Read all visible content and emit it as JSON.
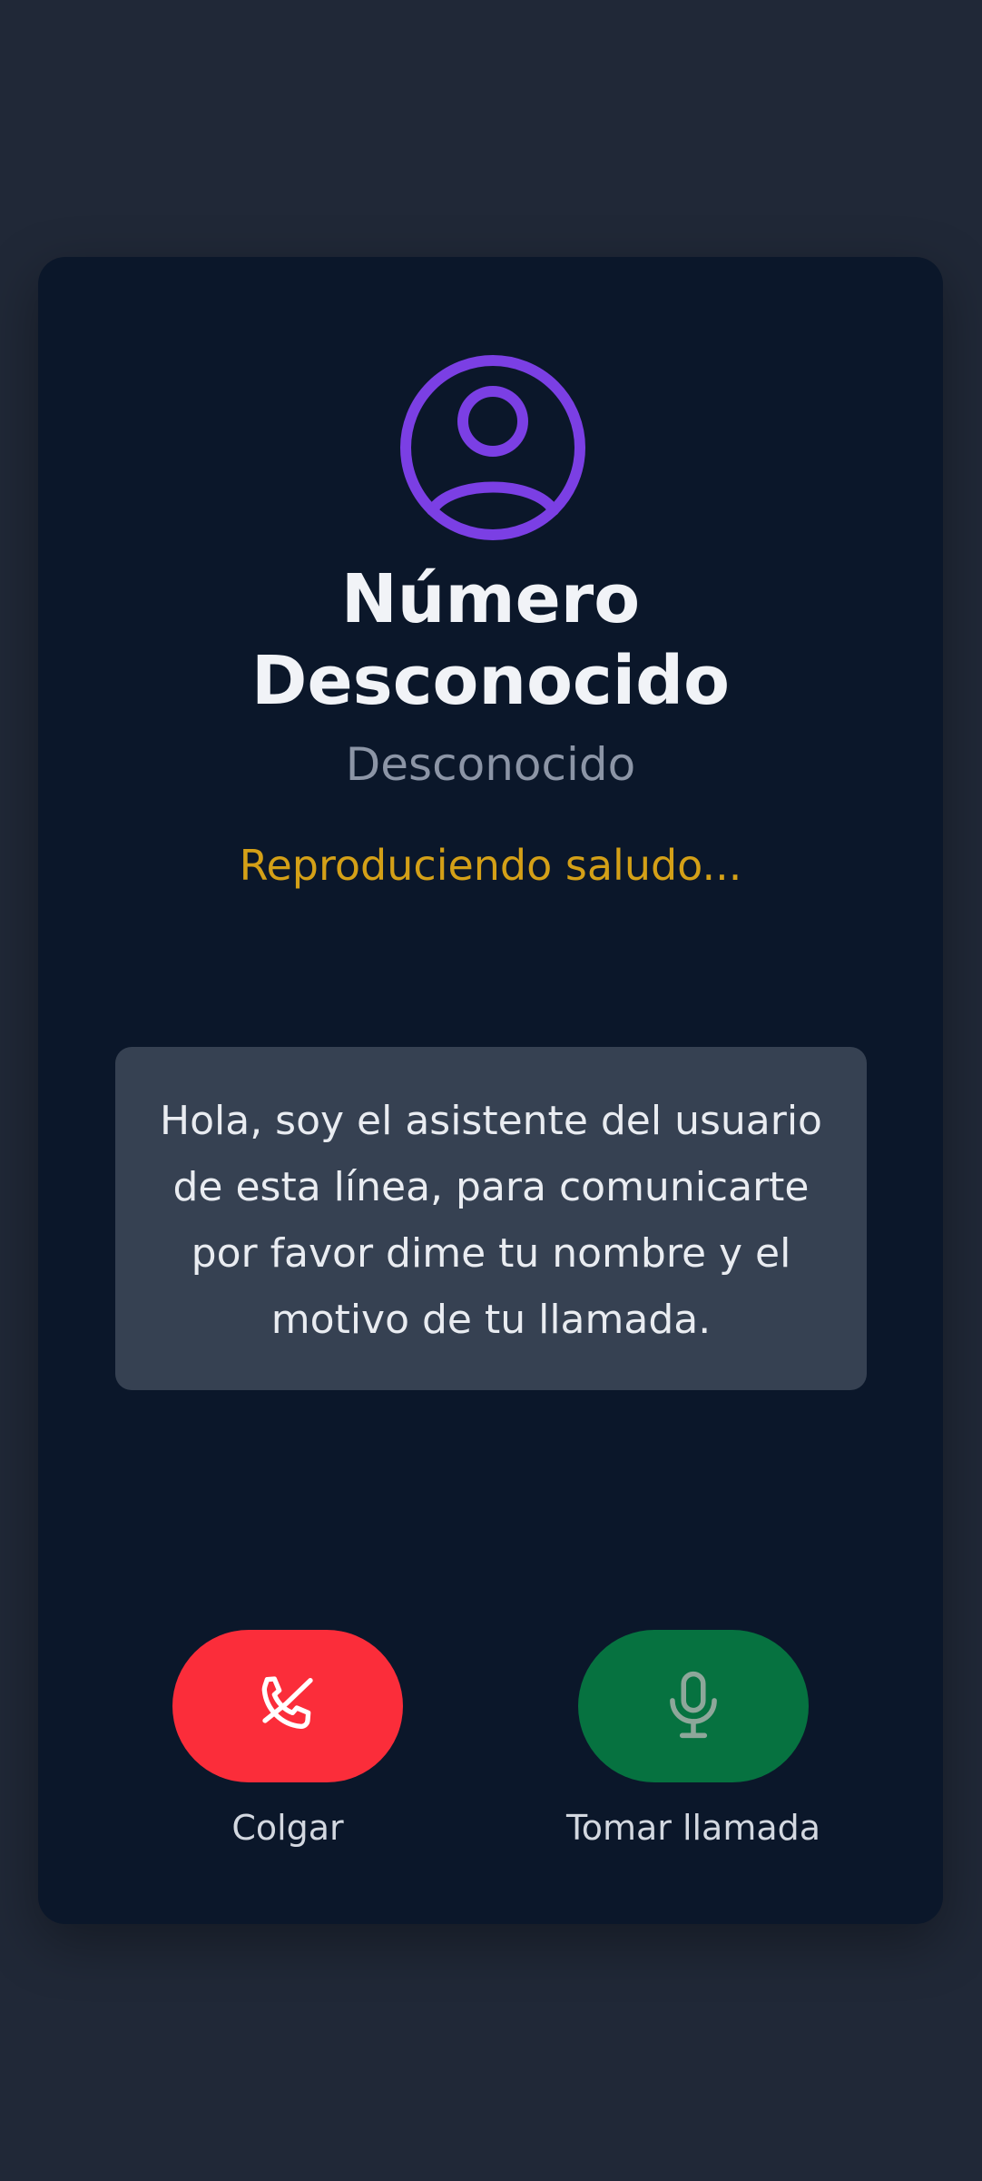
{
  "caller": {
    "name": "Número\nDesconocido",
    "subtitle": "Desconocido",
    "status": "Reproduciendo saludo..."
  },
  "greeting_message": "Hola, soy el asistente del usuario de esta línea, para comunicarte por favor dime tu nombre y el motivo de tu llamada.",
  "actions": {
    "hangup": {
      "label": "Colgar",
      "icon": "phone-hangup-icon",
      "color": "#fb2d3a"
    },
    "accept": {
      "label": "Tomar llamada",
      "icon": "microphone-icon",
      "color": "#067240"
    }
  },
  "colors": {
    "background": "#202837",
    "card": "#0b172a",
    "avatar_accent": "#7b3fe4",
    "status_text": "#d4a017",
    "message_box": "#364152"
  }
}
